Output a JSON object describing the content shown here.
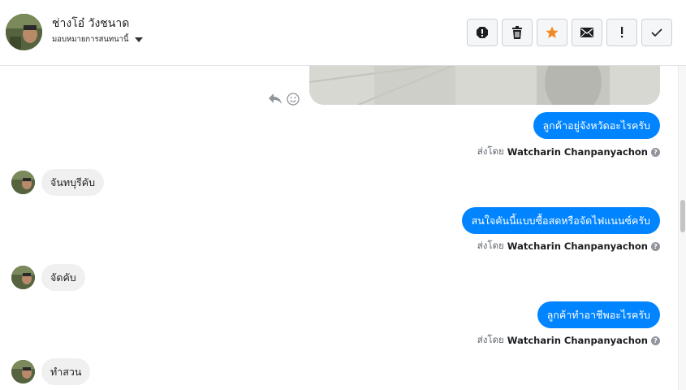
{
  "header": {
    "contact_name": "ช่างโอ๋ วังชนาด",
    "assign_label": "มอบหมายการสนทนานี้"
  },
  "toolbar": {
    "icons": [
      "spam-alert-icon",
      "trash-icon",
      "star-icon",
      "envelope-icon",
      "exclamation-icon",
      "checkmark-icon"
    ],
    "star_color": "#f08a24"
  },
  "thread": {
    "messages": [
      {
        "direction": "out",
        "text": "ลูกค้าอยู่จังหวัดอะไรครับ",
        "sent_by_prefix": "ส่งโดย",
        "sender": "Watcharin Chanpanyachon"
      },
      {
        "direction": "in",
        "text": "จันทบุรีคับ"
      },
      {
        "direction": "out",
        "text": "สนใจคันนี้แบบซื้อสดหรือจัดไฟแนนซ์ครับ",
        "sent_by_prefix": "ส่งโดย",
        "sender": "Watcharin Chanpanyachon"
      },
      {
        "direction": "in",
        "text": "จัดคับ"
      },
      {
        "direction": "out",
        "text": "ลูกค้าทำอาชีพอะไรครับ",
        "sent_by_prefix": "ส่งโดย",
        "sender": "Watcharin Chanpanyachon"
      },
      {
        "direction": "in",
        "text": "ทำสวน"
      }
    ]
  },
  "colors": {
    "outgoing_bubble": "#0084ff",
    "incoming_bubble": "#f1f0f0"
  }
}
